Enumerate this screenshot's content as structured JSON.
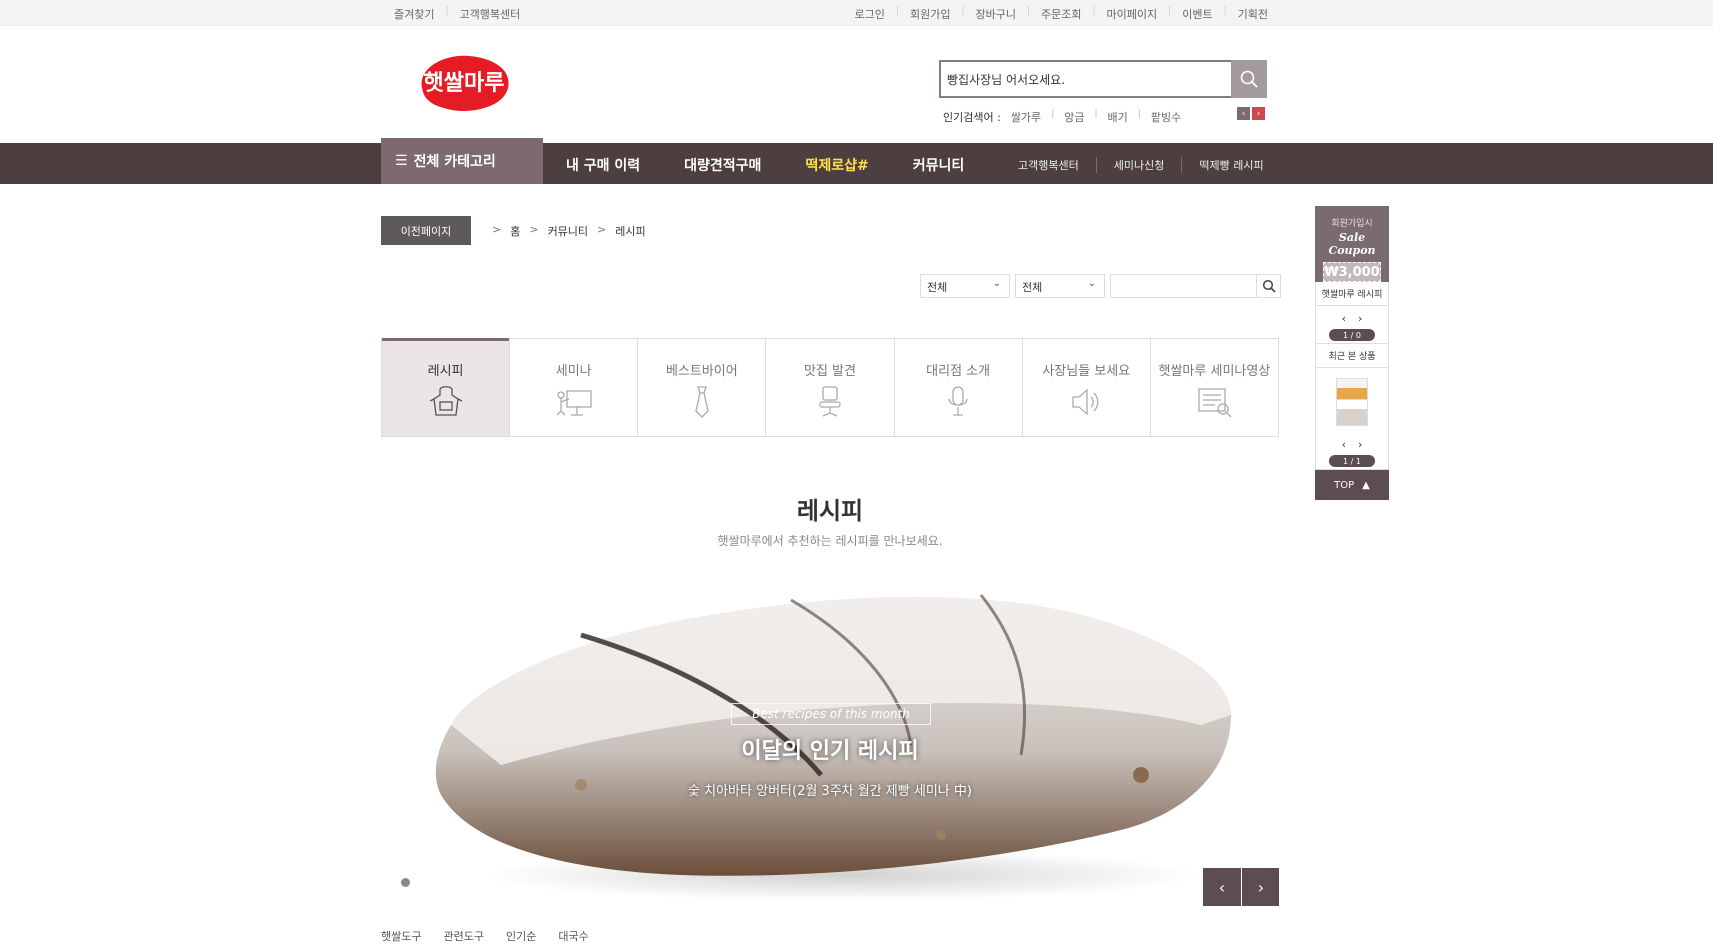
{
  "topbar": {
    "left": [
      "즐겨찾기",
      "고객행복센터"
    ],
    "right": [
      "로그인",
      "회원가입",
      "장바구니",
      "주문조회",
      "마이페이지",
      "이벤트",
      "기획전"
    ]
  },
  "logo": {
    "text": "햇쌀마루",
    "color": "#e51c23"
  },
  "search": {
    "value": "빵집사장님 어서오세요."
  },
  "popular": {
    "label": "인기검색어 :",
    "keywords": [
      "쌀가루",
      "앙금",
      "배기",
      "팥빙수"
    ]
  },
  "gnb": {
    "all_category": "전체 카테고리",
    "main": [
      "내 구매 이력",
      "대량견적구매",
      "떡제로샵#",
      "커뮤니티"
    ],
    "sub": [
      "고객행복센터",
      "세미나신청",
      "떡제빵 레시피"
    ]
  },
  "location": {
    "prev": "이전페이지",
    "crumbs": [
      "홈",
      "커뮤니티",
      "레시피"
    ]
  },
  "filter": {
    "select1": "전체",
    "select2": "전체"
  },
  "tabs": [
    {
      "label": "레시피",
      "icon": "apron-icon"
    },
    {
      "label": "세미나",
      "icon": "presentation-icon"
    },
    {
      "label": "베스트바이어",
      "icon": "tie-icon"
    },
    {
      "label": "맛집 발견",
      "icon": "chair-icon"
    },
    {
      "label": "대리점 소개",
      "icon": "microphone-icon"
    },
    {
      "label": "사장님들 보세요",
      "icon": "speaker-icon"
    },
    {
      "label": "햇쌀마루 세미나영상",
      "icon": "video-document-icon"
    }
  ],
  "section": {
    "title": "레시피",
    "subtitle": "햇쌀마루에서 추천하는 레시피를 만나보세요."
  },
  "banner": {
    "kicker": "Best recipes of this month",
    "title": "이달의 인기 레시피",
    "desc": "숯 치아바타 앙버터(2월 3주차 월간 제빵 세미나 中)"
  },
  "bottom_tags": [
    "햇쌀도구",
    "관련도구",
    "인기순",
    "대국수"
  ],
  "quick": {
    "coupon_line1": "회원가입시",
    "coupon_line2": "Sale Coupon",
    "coupon_amount": "₩3,000",
    "recipe_label": "햇쌀마루 레시피",
    "recipe_page": "1 / 0",
    "recent_label": "최근 본 상품",
    "recent_page": "1 / 1",
    "top": "TOP"
  }
}
